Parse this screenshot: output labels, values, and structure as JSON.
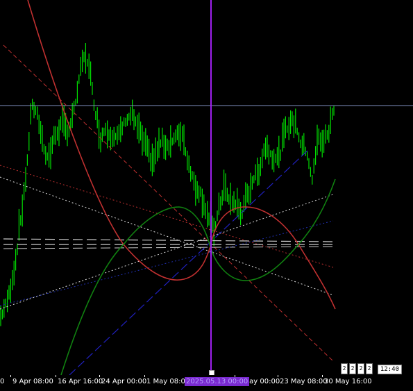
{
  "time_axis": {
    "labels": [
      "0",
      "9 Apr 08:00",
      "16 Apr 16:00",
      "24 Apr 00:00",
      "1 May 08:00",
      "6 May 00:00",
      "23 May 08:00",
      "30 May 16:00"
    ],
    "cursor_label": "2025.05.13 00:00"
  },
  "time_badge": "12:40",
  "shortcut_labels": [
    "2",
    "2",
    "2",
    "2"
  ],
  "colors": {
    "background": "#000000",
    "candles": "#00e000",
    "cursor_line": "#a020f0",
    "price_line": "#8090c0",
    "red_curve": "#c03030",
    "green_curve": "#108010",
    "blue_line": "#2020c0"
  }
}
